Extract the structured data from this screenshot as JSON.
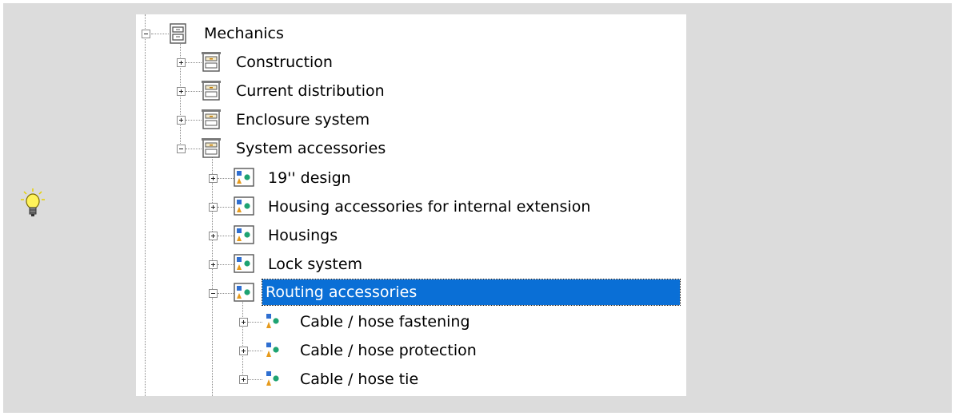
{
  "tree": {
    "root": {
      "label": "Mechanics",
      "icon": "cabinet-icon",
      "expanded": true
    },
    "groups": [
      {
        "label": "Construction",
        "icon": "drawer-cabinet-icon",
        "expanded": false
      },
      {
        "label": "Current distribution",
        "icon": "drawer-cabinet-icon",
        "expanded": false
      },
      {
        "label": "Enclosure system",
        "icon": "drawer-cabinet-icon",
        "expanded": false
      },
      {
        "label": "System accessories",
        "icon": "drawer-cabinet-icon",
        "expanded": true
      }
    ],
    "categories": [
      {
        "label": "19'' design",
        "icon": "shapes-framed-icon",
        "expanded": false
      },
      {
        "label": "Housing accessories for internal extension",
        "icon": "shapes-framed-icon",
        "expanded": false
      },
      {
        "label": "Housings",
        "icon": "shapes-framed-icon",
        "expanded": false
      },
      {
        "label": "Lock system",
        "icon": "shapes-framed-icon",
        "expanded": false
      },
      {
        "label": "Routing accessories",
        "icon": "shapes-framed-icon",
        "expanded": true,
        "selected": true
      }
    ],
    "leaves": [
      {
        "label": "Cable / hose fastening",
        "icon": "shapes-icon",
        "expanded": false
      },
      {
        "label": "Cable / hose protection",
        "icon": "shapes-icon",
        "expanded": false
      },
      {
        "label": "Cable / hose tie",
        "icon": "shapes-icon",
        "expanded": false
      }
    ]
  },
  "hint": {
    "icon": "lightbulb-icon"
  },
  "colors": {
    "selection": "#0a6fd6",
    "panel_bg": "#dcdcdc"
  }
}
